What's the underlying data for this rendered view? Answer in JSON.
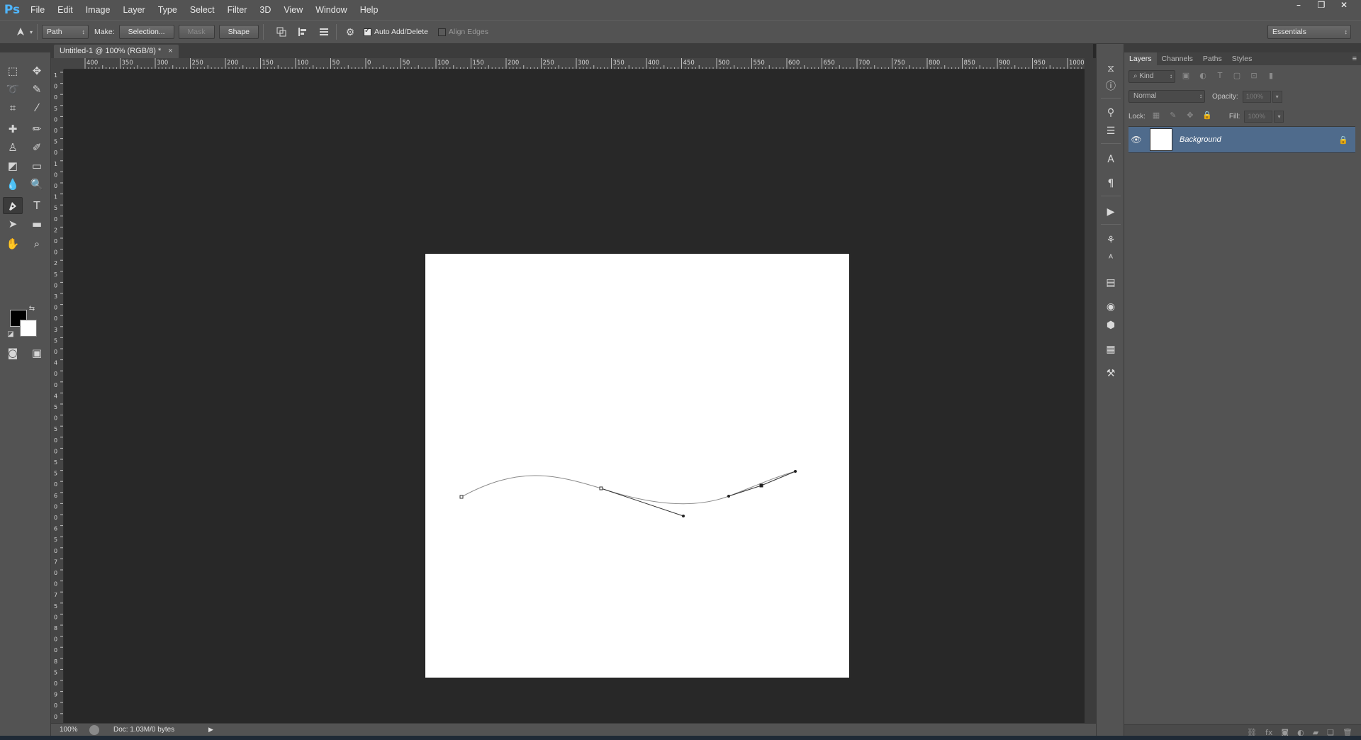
{
  "app": {
    "logo": "Ps"
  },
  "menu": [
    "File",
    "Edit",
    "Image",
    "Layer",
    "Type",
    "Select",
    "Filter",
    "3D",
    "View",
    "Window",
    "Help"
  ],
  "window_controls": {
    "minimize": "–",
    "restore": "❐",
    "close": "✕"
  },
  "options_bar": {
    "tool_mode": "Path",
    "make_label": "Make:",
    "selection_button": "Selection...",
    "mask_button": "Mask",
    "shape_button": "Shape",
    "auto_add_delete_label": "Auto Add/Delete",
    "auto_add_delete_checked": true,
    "align_edges_label": "Align Edges",
    "align_edges_checked": false,
    "workspace": "Essentials"
  },
  "document": {
    "tab_title": "Untitled-1 @ 100% (RGB/8) *",
    "tab_close": "×"
  },
  "ruler": {
    "horizontal_labels": [
      "400",
      "350",
      "300",
      "250",
      "200",
      "150",
      "100",
      "50",
      "0",
      "50",
      "100",
      "150",
      "200",
      "250",
      "300",
      "350",
      "400",
      "450",
      "500",
      "550",
      "600",
      "650",
      "700",
      "750",
      "800",
      "850",
      "900",
      "950",
      "1000"
    ],
    "vertical_labels": [
      "1",
      "0",
      "0",
      "5",
      "0",
      "0",
      "5",
      "0",
      "1",
      "0",
      "0",
      "1",
      "5",
      "0",
      "2",
      "0",
      "0",
      "2",
      "5",
      "0",
      "3",
      "0",
      "0",
      "3",
      "5",
      "0",
      "4",
      "0",
      "0",
      "4",
      "5",
      "0",
      "5",
      "0",
      "0",
      "5",
      "5",
      "0",
      "6",
      "0",
      "0",
      "6",
      "5",
      "0",
      "7",
      "0",
      "0",
      "7",
      "5",
      "0",
      "8",
      "0",
      "0",
      "8",
      "5",
      "0",
      "9",
      "0",
      "0"
    ]
  },
  "status_bar": {
    "zoom": "100%",
    "doc_info": "Doc: 1.03M/0 bytes",
    "arrow": "▶"
  },
  "layers_panel": {
    "tabs": [
      "Layers",
      "Channels",
      "Paths",
      "Styles"
    ],
    "active_tab": "Layers",
    "filter_kind": "⌕ Kind",
    "blend_mode": "Normal",
    "opacity_label": "Opacity:",
    "opacity_value": "100%",
    "lock_label": "Lock:",
    "fill_label": "Fill:",
    "fill_value": "100%",
    "layers": [
      {
        "name": "Background",
        "visible": true,
        "locked": true,
        "selected": true
      }
    ]
  },
  "colors": {
    "foreground": "#000000",
    "background": "#ffffff",
    "selection_accent": "#4f6b8c",
    "logo": "#4fb6ff"
  },
  "icons": {
    "dock": [
      "history-icon",
      "info-icon",
      "brush-presets-icon",
      "adjustments-icon",
      "character-icon",
      "paragraph-icon",
      "play-actions-icon",
      "clone-source-icon",
      "character-styles-icon",
      "notes-icon",
      "kuler-icon",
      "3d-icon",
      "measurement-icon",
      "tool-presets-icon"
    ]
  }
}
